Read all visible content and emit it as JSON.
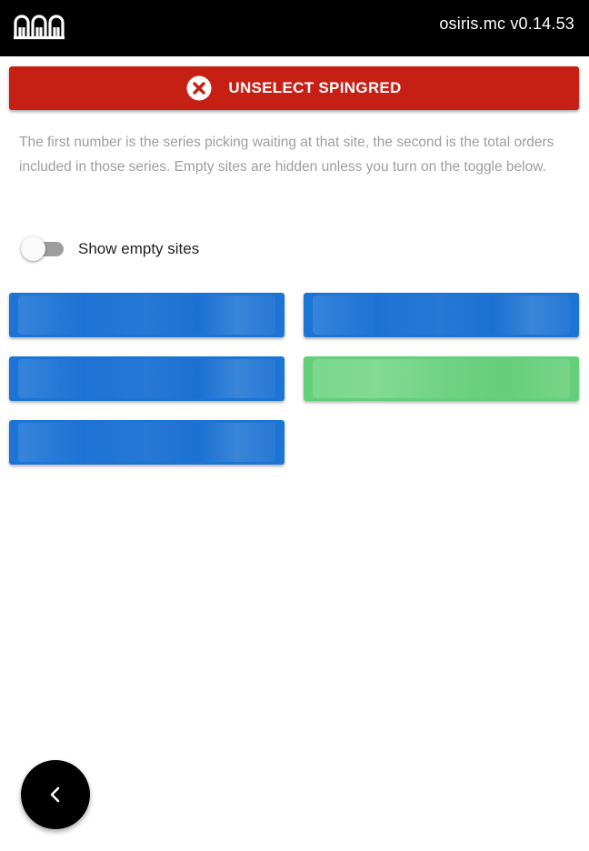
{
  "header": {
    "logo_icon": "arches-logo-icon",
    "version": "osiris.mc v0.14.53"
  },
  "unselect_button": {
    "label": "UNSELECT SPINGRED",
    "icon": "close-circle-icon",
    "color": "#c62015"
  },
  "help_text": "The first number is the series picking waiting at that site, the second is the total orders included in those series. Empty sites are hidden unless you turn on the toggle below.",
  "empty_sites_toggle": {
    "label": "Show empty sites",
    "checked": false
  },
  "sites": [
    {
      "color": "#1c74d4"
    },
    {
      "color": "#1c74d4"
    },
    {
      "color": "#1c74d4"
    },
    {
      "color": "#63cf78"
    },
    {
      "color": "#1c74d4"
    }
  ],
  "back_button": {
    "icon": "chevron-left-icon"
  }
}
